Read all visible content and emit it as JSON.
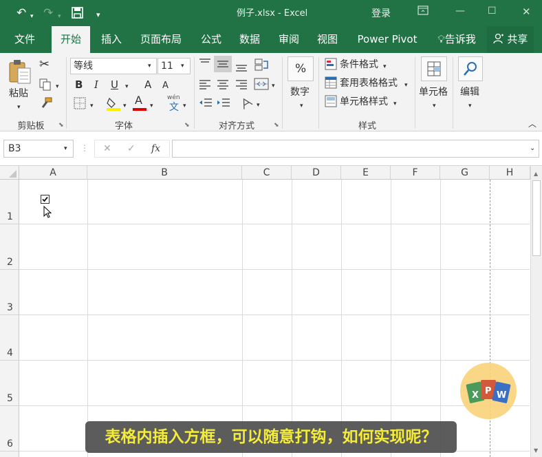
{
  "title_bar": {
    "document_title": "例子.xlsx  -  Excel",
    "login_label": "登录"
  },
  "quick_access": {
    "undo_icon": "undo-icon",
    "redo_icon": "redo-icon",
    "save_icon": "save-icon",
    "customize_icon": "customize-qat-icon"
  },
  "tabs": [
    {
      "label": "文件"
    },
    {
      "label": "开始"
    },
    {
      "label": "插入"
    },
    {
      "label": "页面布局"
    },
    {
      "label": "公式"
    },
    {
      "label": "数据"
    },
    {
      "label": "审阅"
    },
    {
      "label": "视图"
    },
    {
      "label": "Power Pivot"
    }
  ],
  "tell_me": {
    "label": "告诉我"
  },
  "share": {
    "label": "共享"
  },
  "ribbon": {
    "clipboard": {
      "paste_label": "粘贴",
      "group_label": "剪贴板"
    },
    "font": {
      "font_name": "等线",
      "font_size": "11",
      "bold": "B",
      "italic": "I",
      "underline": "U",
      "grow": "A",
      "shrink": "A",
      "phonetic_top": "wén",
      "phonetic_bottom": "文",
      "font_color_letter": "A",
      "group_label": "字体"
    },
    "alignment": {
      "group_label": "对齐方式"
    },
    "number": {
      "symbol": "%",
      "label": "数字"
    },
    "styles": {
      "conditional": "条件格式",
      "table_format": "套用表格格式",
      "cell_styles": "单元格样式",
      "group_label": "样式"
    },
    "cells": {
      "label": "单元格"
    },
    "editing": {
      "label": "编辑"
    }
  },
  "formula_bar": {
    "name_box": "B3",
    "cancel": "✕",
    "enter": "✓",
    "fx": "fx",
    "value": ""
  },
  "columns": [
    "A",
    "B",
    "C",
    "D",
    "E",
    "F",
    "G",
    "H"
  ],
  "rows": [
    "1",
    "2",
    "3",
    "4",
    "5",
    "6"
  ],
  "checkbox": {
    "checked": true
  },
  "watermark": {
    "letters": [
      "X",
      "P",
      "W"
    ]
  },
  "caption": "表格内插入方框，可以随意打钩，如何实现呢？"
}
